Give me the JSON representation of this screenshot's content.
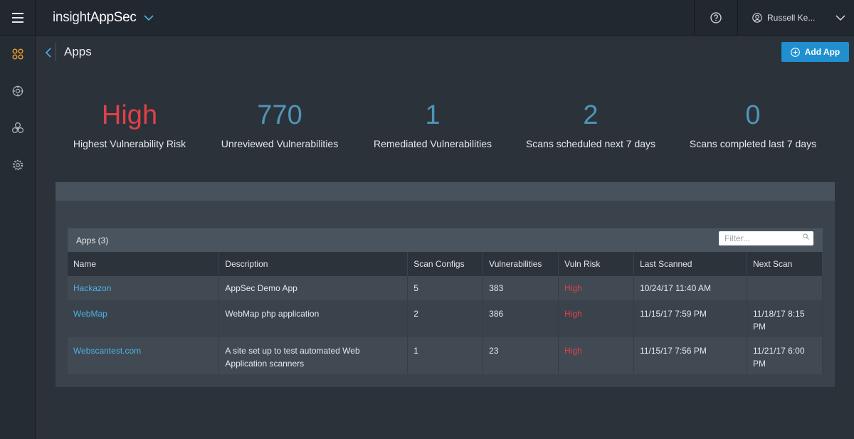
{
  "brand": {
    "light": "insight",
    "bold": "AppSec"
  },
  "user": {
    "name": "Russell Ke..."
  },
  "nav": {
    "items": [
      "apps-icon",
      "target-icon",
      "biohazard-icon",
      "gear-icon"
    ]
  },
  "page": {
    "title": "Apps",
    "add_button": "Add App"
  },
  "stats": [
    {
      "value": "High",
      "label": "Highest Vulnerability Risk",
      "color": "#e0404a"
    },
    {
      "value": "770",
      "label": "Unreviewed Vulnerabilities",
      "color": "#4f95b8"
    },
    {
      "value": "1",
      "label": "Remediated Vulnerabilities",
      "color": "#4f95b8"
    },
    {
      "value": "2",
      "label": "Scans scheduled next 7 days",
      "color": "#4f95b8"
    },
    {
      "value": "0",
      "label": "Scans completed last 7 days",
      "color": "#4f95b8"
    }
  ],
  "apps_table": {
    "title": "Apps (3)",
    "filter_placeholder": "Filter...",
    "columns": [
      "Name",
      "Description",
      "Scan Configs",
      "Vulnerabilities",
      "Vuln Risk",
      "Last Scanned",
      "Next Scan"
    ],
    "rows": [
      {
        "name": "Hackazon",
        "description": "AppSec Demo App",
        "scan_configs": "5",
        "vulnerabilities": "383",
        "risk": "High",
        "last_scanned": "10/24/17 11:40 AM",
        "next_scan": ""
      },
      {
        "name": "WebMap",
        "description": "WebMap php application",
        "scan_configs": "2",
        "vulnerabilities": "386",
        "risk": "High",
        "last_scanned": "11/15/17 7:59 PM",
        "next_scan": "11/18/17 8:15 PM"
      },
      {
        "name": "Webscantest.com",
        "description": "A site set up to test automated Web Application scanners",
        "scan_configs": "1",
        "vulnerabilities": "23",
        "risk": "High",
        "last_scanned": "11/15/17 7:56 PM",
        "next_scan": "11/21/17 6:00 PM"
      }
    ]
  },
  "colors": {
    "accent": "#1f8fd0",
    "link": "#4fb0e4",
    "risk_high": "#e0404a",
    "nav_active": "#f0a030"
  }
}
